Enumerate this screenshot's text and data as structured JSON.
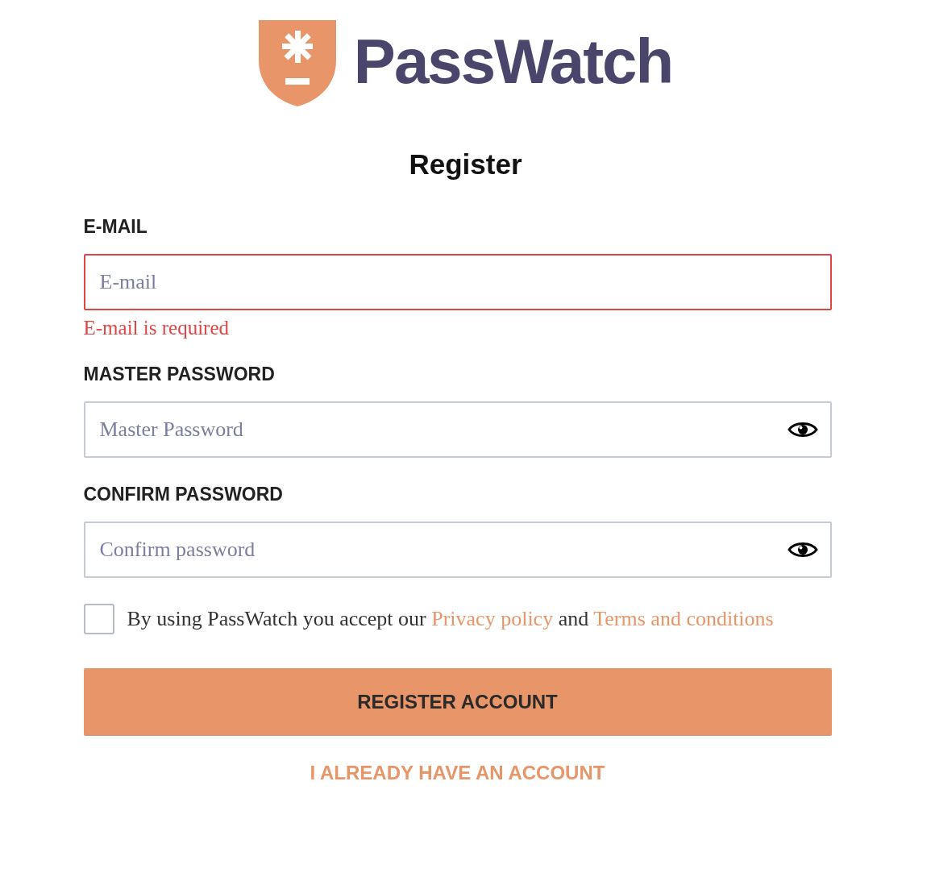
{
  "logo": {
    "name": "PassWatch"
  },
  "title": "Register",
  "fields": [
    {
      "kind": "email",
      "label": "E-MAIL",
      "placeholder": "E-mail",
      "invalid": true,
      "error": "E-mail is required"
    },
    {
      "kind": "password",
      "label": "MASTER PASSWORD",
      "placeholder": "Master Password",
      "invalid": false
    },
    {
      "kind": "password",
      "label": "CONFIRM PASSWORD",
      "placeholder": "Confirm password",
      "invalid": false
    }
  ],
  "terms": {
    "checked": false,
    "parts": [
      {
        "kind": "text",
        "text": "By using PassWatch you accept our"
      },
      {
        "kind": "link",
        "text": "Privacy policy"
      },
      {
        "kind": "text",
        "text": "and"
      },
      {
        "kind": "link",
        "text": "Terms and conditions"
      }
    ]
  },
  "primary_button": "REGISTER ACCOUNT",
  "secondary_link": "I ALREADY HAVE AN ACCOUNT"
}
